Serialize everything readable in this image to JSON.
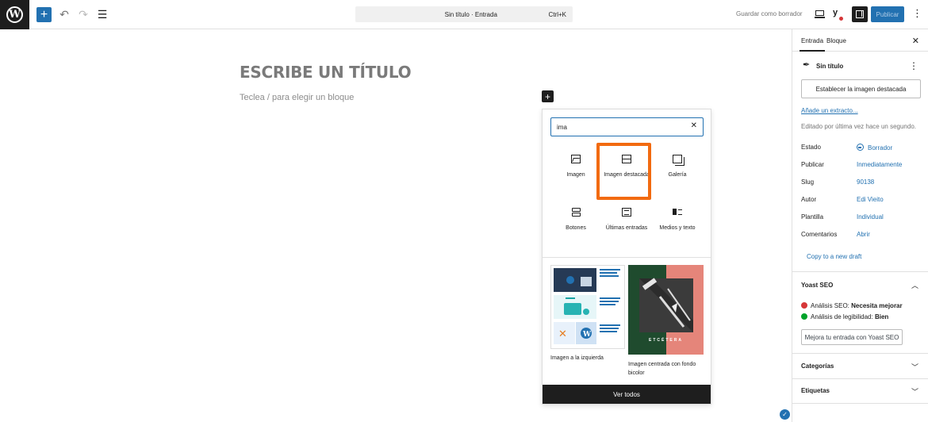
{
  "toolbar": {
    "doc_title": "Sin título · Entrada",
    "shortcut": "Ctrl+K",
    "save_draft": "Guardar como borrador",
    "publish": "Publicar"
  },
  "editor": {
    "title_placeholder": "ESCRIBE UN TÍTULO",
    "block_placeholder": "Teclea / para elegir un bloque"
  },
  "inserter": {
    "search_value": "ima",
    "blocks": [
      {
        "label": "Imagen"
      },
      {
        "label": "Imagen destacada"
      },
      {
        "label": "Galería"
      },
      {
        "label": "Botones"
      },
      {
        "label": "Últimas entradas"
      },
      {
        "label": "Medios y texto"
      }
    ],
    "patterns": [
      {
        "label": "Imagen a la izquierda"
      },
      {
        "label": "Imagen centrada con fondo bicolor"
      }
    ],
    "pattern_text": "ETCÉTERA",
    "view_all": "Ver todos",
    "highlight_color": "#f26a10"
  },
  "sidebar": {
    "tabs": [
      "Entrada",
      "Bloque"
    ],
    "doc_title": "Sin título",
    "featured_btn": "Establecer la imagen destacada",
    "excerpt_link": "Añade un extracto...",
    "edited": "Editado por última vez hace un segundo.",
    "rows": [
      {
        "label": "Estado",
        "value": "Borrador"
      },
      {
        "label": "Publicar",
        "value": "Inmediatamente"
      },
      {
        "label": "Slug",
        "value": "90138"
      },
      {
        "label": "Autor",
        "value": "Edi Vieito"
      },
      {
        "label": "Plantilla",
        "value": "Individual"
      },
      {
        "label": "Comentarios",
        "value": "Abrir"
      }
    ],
    "copy_draft": "Copy to a new draft",
    "yoast": {
      "title": "Yoast SEO",
      "seo_prefix": "Análisis SEO: ",
      "seo_value": "Necesita mejorar",
      "read_prefix": "Análisis de legibilidad: ",
      "read_value": "Bien",
      "button": "Mejora tu entrada con Yoast SEO"
    },
    "categories": "Categorías",
    "tags": "Etiquetas"
  },
  "colors": {
    "accent": "#2271b1",
    "seo_bad": "#d63638",
    "seo_good": "#00a32a"
  }
}
